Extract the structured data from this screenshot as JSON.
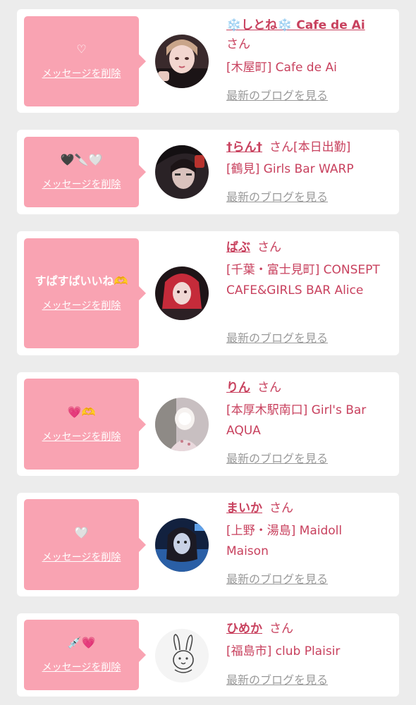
{
  "delete_label": "メッセージを削除",
  "blog_label": "最新のブログを見る",
  "honorific": "さん",
  "colors": {
    "bubble": "#f9a3b2",
    "accent": "#c8415e",
    "muted": "#9a9a9a",
    "background": "#ececec"
  },
  "entries": [
    {
      "message": "♡",
      "name": "❄️しとね❄️ Cafe de Ai",
      "status": "",
      "shop": "[木屋町] Cafe de Ai",
      "avatar_icon": "profile-photo-icon"
    },
    {
      "message": "🖤🔪🤍",
      "name": "†らん†",
      "status": "[本日出勤]",
      "shop": "[鶴見] Girls Bar WARP",
      "avatar_icon": "profile-photo-icon"
    },
    {
      "message": "すぱすぱいいね🫶",
      "name": "ばぶ",
      "status": "",
      "shop": "[千葉・富士見町] CONSEPT CAFE&GIRLS BAR Alice",
      "avatar_icon": "profile-photo-icon"
    },
    {
      "message": "💗🫶",
      "name": "りん",
      "status": "",
      "shop": "[本厚木駅南口] Girl's Bar AQUA",
      "avatar_icon": "profile-photo-icon"
    },
    {
      "message": "🤍",
      "name": "まいか",
      "status": "",
      "shop": "[上野・湯島] Maidoll Maison",
      "avatar_icon": "profile-photo-icon"
    },
    {
      "message": "💉💗",
      "name": "ひめか",
      "status": "",
      "shop": "[福島市] club Plaisir",
      "avatar_icon": "bunny-drawing-icon"
    }
  ]
}
